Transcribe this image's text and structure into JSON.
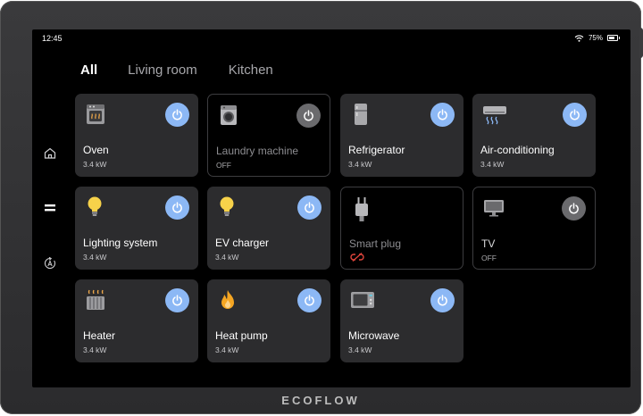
{
  "status": {
    "time": "12:45",
    "battery": "75%",
    "battery_level": 0.75
  },
  "tabs": [
    {
      "label": "All",
      "active": true
    },
    {
      "label": "Living room",
      "active": false
    },
    {
      "label": "Kitchen",
      "active": false
    }
  ],
  "nav_icons": [
    "home-icon",
    "menu-icon",
    "automation-icon"
  ],
  "devices": [
    {
      "name": "Oven",
      "value": "3.4 kW",
      "on": true,
      "icon": "oven-icon"
    },
    {
      "name": "Laundry machine",
      "value": "OFF",
      "on": false,
      "icon": "washing-machine-icon"
    },
    {
      "name": "Refrigerator",
      "value": "3.4 kW",
      "on": true,
      "icon": "refrigerator-icon"
    },
    {
      "name": "Air-conditioning",
      "value": "3.4 kW",
      "on": true,
      "icon": "air-conditioner-icon"
    },
    {
      "name": "Lighting system",
      "value": "3.4 kW",
      "on": true,
      "icon": "light-bulb-icon"
    },
    {
      "name": "EV charger",
      "value": "3.4 kW",
      "on": true,
      "icon": "light-bulb-icon"
    },
    {
      "name": "Smart plug",
      "value": "",
      "on": false,
      "icon": "smart-plug-icon",
      "status_icon": "disconnected-link-icon"
    },
    {
      "name": "TV",
      "value": "OFF",
      "on": false,
      "icon": "tv-icon"
    },
    {
      "name": "Heater",
      "value": "3.4 kW",
      "on": true,
      "icon": "heater-icon"
    },
    {
      "name": "Heat pump",
      "value": "3.4 kW",
      "on": true,
      "icon": "flame-icon"
    },
    {
      "name": "Microwave",
      "value": "3.4 kW",
      "on": true,
      "icon": "microwave-icon"
    }
  ],
  "brand": "ECOFLOW",
  "colors": {
    "accent": "#8cb8f5",
    "card_on": "#2c2c2e",
    "power_off": "#6a6a6d",
    "alert": "#e0453c",
    "bulb": "#f7d24a",
    "flame": "#f5a623"
  }
}
